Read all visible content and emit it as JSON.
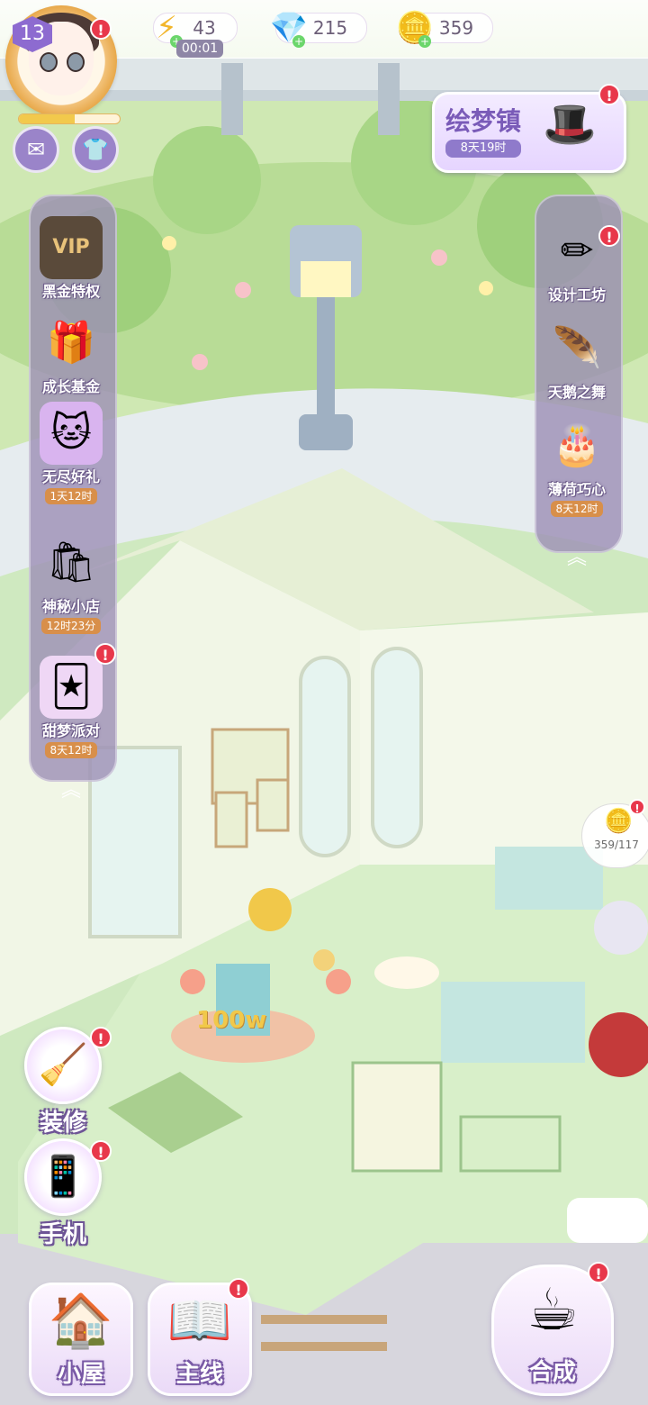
{
  "player": {
    "level": "13"
  },
  "resources": {
    "energy": {
      "value": "43",
      "timer": "00:01",
      "icon": "lightning-icon"
    },
    "gems": {
      "value": "215",
      "icon": "diamond-icon"
    },
    "coins": {
      "value": "359",
      "icon": "coin-icon"
    }
  },
  "event_banner": {
    "title": "绘梦镇",
    "timer": "8天19时"
  },
  "left_sidebar": [
    {
      "label": "黑金特权",
      "icon": "vip-card-icon",
      "badge_text": "VIP"
    },
    {
      "label": "成长基金",
      "icon": "gift-box-icon"
    },
    {
      "label": "无尽好礼",
      "icon": "cat-gift-icon",
      "timer": "1天12时"
    },
    {
      "label": "神秘小店",
      "icon": "shop-gifts-icon",
      "timer": "12时23分"
    },
    {
      "label": "甜梦派对",
      "icon": "party-cards-icon",
      "timer": "8天12时"
    }
  ],
  "right_sidebar": [
    {
      "label": "设计工坊",
      "icon": "pencil-ruler-icon"
    },
    {
      "label": "天鹅之舞",
      "icon": "feather-icon"
    },
    {
      "label": "薄荷巧心",
      "icon": "chocolate-cake-icon",
      "timer": "8天12时"
    }
  ],
  "scene": {
    "coin_collect": "359/117",
    "fountain_sign": "100w"
  },
  "left_actions": [
    {
      "label": "装修",
      "icon": "brush-icon"
    },
    {
      "label": "手机",
      "icon": "phone-icon"
    }
  ],
  "bottom_nav": [
    {
      "label": "小屋",
      "icon": "house-icon"
    },
    {
      "label": "主线",
      "icon": "storybook-icon"
    },
    {
      "label": "合成",
      "icon": "teacup-icon"
    }
  ],
  "colors": {
    "accent_purple": "#9c8fb5",
    "alert_red": "#e8384b",
    "timer_orange": "#d88f4a",
    "floor_green": "#cfe9c0"
  }
}
